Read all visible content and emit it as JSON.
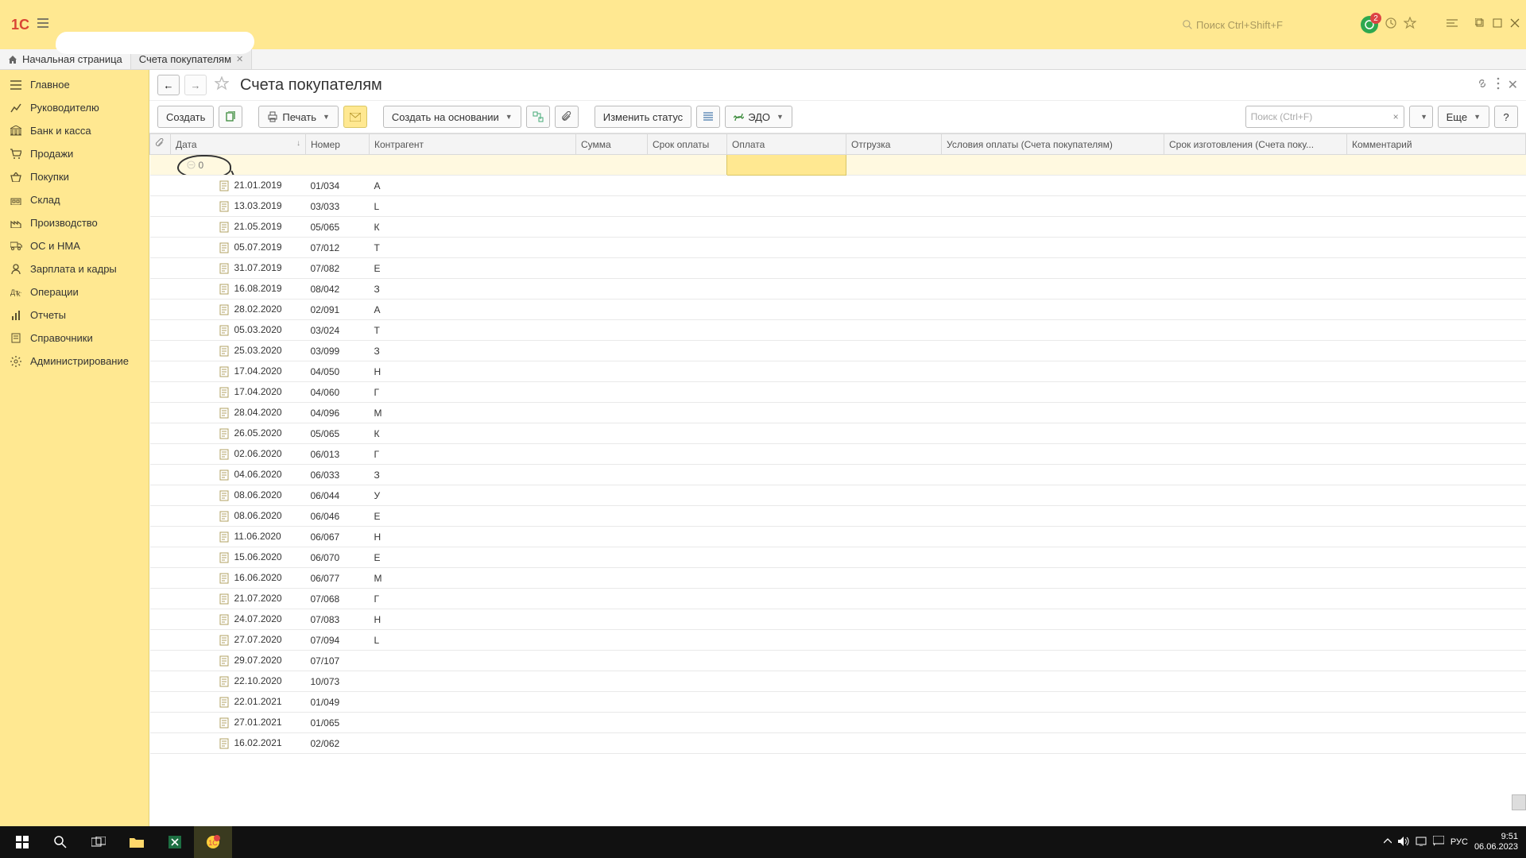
{
  "titlebar": {
    "search_placeholder": "Поиск Ctrl+Shift+F",
    "badge_count": "2"
  },
  "tabs": {
    "home": "Начальная страница",
    "open": [
      {
        "label": "Счета покупателям"
      }
    ]
  },
  "sidebar": {
    "items": [
      {
        "label": "Главное",
        "icon": "menu-icon"
      },
      {
        "label": "Руководителю",
        "icon": "chart-icon"
      },
      {
        "label": "Банк и касса",
        "icon": "bank-icon"
      },
      {
        "label": "Продажи",
        "icon": "cart-icon"
      },
      {
        "label": "Покупки",
        "icon": "basket-icon"
      },
      {
        "label": "Склад",
        "icon": "warehouse-icon"
      },
      {
        "label": "Производство",
        "icon": "factory-icon"
      },
      {
        "label": "ОС и НМА",
        "icon": "truck-icon"
      },
      {
        "label": "Зарплата и кадры",
        "icon": "person-icon"
      },
      {
        "label": "Операции",
        "icon": "operations-icon"
      },
      {
        "label": "Отчеты",
        "icon": "report-icon"
      },
      {
        "label": "Справочники",
        "icon": "book-icon"
      },
      {
        "label": "Администрирование",
        "icon": "gear-icon"
      }
    ]
  },
  "page": {
    "title": "Счета покупателям"
  },
  "toolbar": {
    "create": "Создать",
    "print": "Печать",
    "create_based": "Создать на основании",
    "change_status": "Изменить статус",
    "edo": "ЭДО",
    "search_placeholder": "Поиск (Ctrl+F)",
    "more": "Еще"
  },
  "columns": {
    "attach": "",
    "date": "Дата",
    "number": "Номер",
    "contractor": "Контрагент",
    "sum": "Сумма",
    "due": "Срок оплаты",
    "payment": "Оплата",
    "shipment": "Отгрузка",
    "terms": "Условия оплаты (Счета покупателям)",
    "mfg_date": "Срок изготовления (Счета поку...",
    "comment": "Комментарий"
  },
  "filter": {
    "date_value": "0"
  },
  "rows": [
    {
      "date": "21.01.2019",
      "number": "01/034",
      "contractor": "А"
    },
    {
      "date": "13.03.2019",
      "number": "03/033",
      "contractor": "L"
    },
    {
      "date": "21.05.2019",
      "number": "05/065",
      "contractor": "К"
    },
    {
      "date": "05.07.2019",
      "number": "07/012",
      "contractor": "Т"
    },
    {
      "date": "31.07.2019",
      "number": "07/082",
      "contractor": "Е"
    },
    {
      "date": "16.08.2019",
      "number": "08/042",
      "contractor": "З"
    },
    {
      "date": "28.02.2020",
      "number": "02/091",
      "contractor": "А"
    },
    {
      "date": "05.03.2020",
      "number": "03/024",
      "contractor": "Т"
    },
    {
      "date": "25.03.2020",
      "number": "03/099",
      "contractor": "З"
    },
    {
      "date": "17.04.2020",
      "number": "04/050",
      "contractor": "Н"
    },
    {
      "date": "17.04.2020",
      "number": "04/060",
      "contractor": "Г"
    },
    {
      "date": "28.04.2020",
      "number": "04/096",
      "contractor": "М"
    },
    {
      "date": "26.05.2020",
      "number": "05/065",
      "contractor": "К"
    },
    {
      "date": "02.06.2020",
      "number": "06/013",
      "contractor": "Г"
    },
    {
      "date": "04.06.2020",
      "number": "06/033",
      "contractor": "З"
    },
    {
      "date": "08.06.2020",
      "number": "06/044",
      "contractor": "У"
    },
    {
      "date": "08.06.2020",
      "number": "06/046",
      "contractor": "Е"
    },
    {
      "date": "11.06.2020",
      "number": "06/067",
      "contractor": "Н"
    },
    {
      "date": "15.06.2020",
      "number": "06/070",
      "contractor": "Е"
    },
    {
      "date": "16.06.2020",
      "number": "06/077",
      "contractor": "М"
    },
    {
      "date": "21.07.2020",
      "number": "07/068",
      "contractor": "Г"
    },
    {
      "date": "24.07.2020",
      "number": "07/083",
      "contractor": "Н"
    },
    {
      "date": "27.07.2020",
      "number": "07/094",
      "contractor": "L"
    },
    {
      "date": "29.07.2020",
      "number": "07/107",
      "contractor": ""
    },
    {
      "date": "22.10.2020",
      "number": "10/073",
      "contractor": ""
    },
    {
      "date": "22.01.2021",
      "number": "01/049",
      "contractor": ""
    },
    {
      "date": "27.01.2021",
      "number": "01/065",
      "contractor": ""
    },
    {
      "date": "16.02.2021",
      "number": "02/062",
      "contractor": ""
    }
  ],
  "taskbar": {
    "lang": "РУС",
    "time": "9:51",
    "date": "06.06.2023"
  }
}
